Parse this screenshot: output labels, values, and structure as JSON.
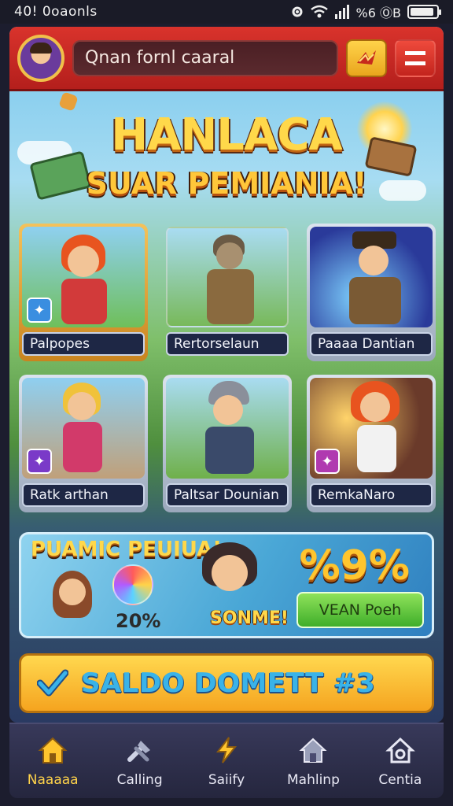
{
  "status_bar": {
    "time": "40! 0oaonls",
    "right_text": "%6 ⓄB"
  },
  "header": {
    "search_text": "Qnan fornl caaral",
    "gift_icon": "gift-icon",
    "menu_icon": "menu-icon"
  },
  "banner": {
    "title_line1": "HANLACA",
    "title_line2": "SUAR PEMIANIA!"
  },
  "characters": [
    {
      "name": "Palpopes"
    },
    {
      "name": "Rertorselaun"
    },
    {
      "name": "Paaaa Dantian"
    },
    {
      "name": "Ratk arthan"
    },
    {
      "name": "Paltsar Dounian"
    },
    {
      "name": "RemkaNaro"
    }
  ],
  "promo": {
    "title": "PUAMIC PEUIUA!",
    "percent": "20%",
    "tag": "SONME!",
    "number": "%9%",
    "button_label": "VEAN Poeh"
  },
  "deposit": {
    "label": "SALDO DOMETT #3"
  },
  "nav": [
    {
      "label": "Naaaaa",
      "icon": "home-icon",
      "active": true
    },
    {
      "label": "Calling",
      "icon": "tools-icon",
      "active": false
    },
    {
      "label": "Saiify",
      "icon": "lightning-icon",
      "active": false
    },
    {
      "label": "Mahlinp",
      "icon": "house-icon",
      "active": false
    },
    {
      "label": "Centia",
      "icon": "gear-house-icon",
      "active": false
    }
  ],
  "colors": {
    "header_red": "#d9332c",
    "gold": "#ffd84a",
    "nav_bg": "#2c2d48",
    "active": "#ffd34a"
  }
}
